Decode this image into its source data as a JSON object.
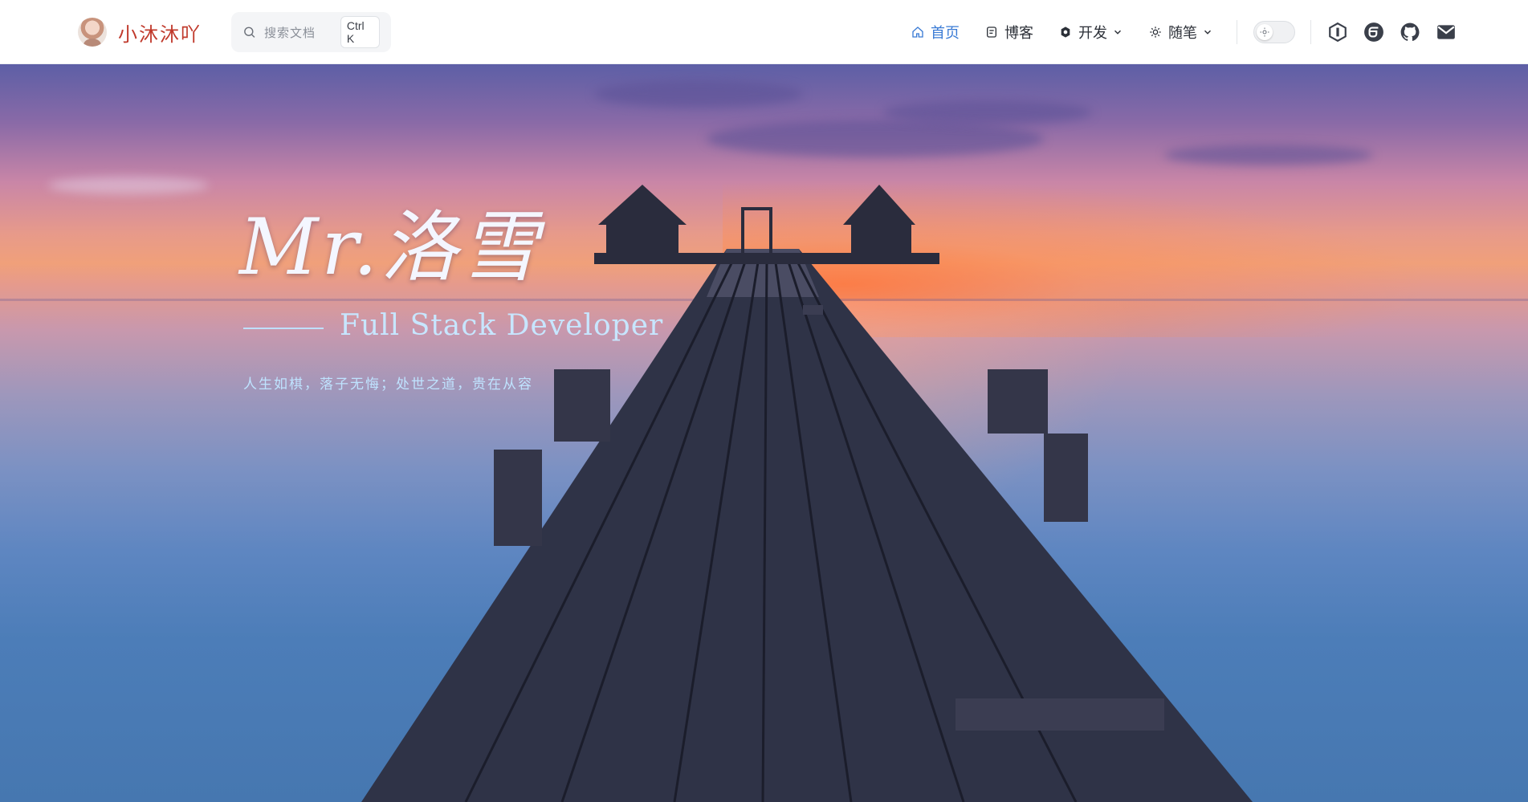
{
  "brand": {
    "name": "小沐沐吖"
  },
  "search": {
    "placeholder": "搜索文档",
    "shortcut": "Ctrl K"
  },
  "nav": {
    "items": [
      {
        "label": "首页",
        "icon": "home-icon",
        "active": true
      },
      {
        "label": "博客",
        "icon": "blog-icon",
        "active": false
      },
      {
        "label": "开发",
        "icon": "dev-icon",
        "active": false,
        "dropdown": true
      },
      {
        "label": "随笔",
        "icon": "essay-icon",
        "active": false,
        "dropdown": true
      }
    ]
  },
  "theme": {
    "mode": "light"
  },
  "social": [
    {
      "name": "hexagon-logo-icon"
    },
    {
      "name": "gitee-icon"
    },
    {
      "name": "github-icon"
    },
    {
      "name": "mail-icon"
    }
  ],
  "hero": {
    "title": "Mr.洛雪",
    "subtitle": "Full Stack Developer",
    "motto": "人生如棋，落子无悔；处世之道，贵在从容"
  },
  "colors": {
    "accent": "#3a7bd5",
    "brand": "#c0392b",
    "hero_text": "#c7e6ff"
  }
}
